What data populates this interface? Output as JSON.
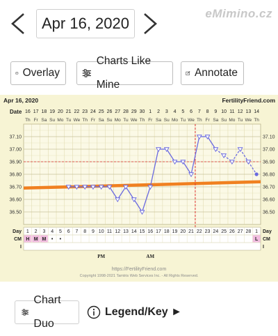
{
  "nav": {
    "date": "Apr 16, 2020",
    "brand": "eMimino.cz"
  },
  "actions": [
    {
      "id": "overlay",
      "label": "Overlay",
      "icon": "overlay-icon"
    },
    {
      "id": "charts_like_mine",
      "label": "Charts Like Mine",
      "icon": "sliders-icon"
    },
    {
      "id": "annotate",
      "label": "Annotate",
      "icon": "edit-icon"
    }
  ],
  "chart": {
    "header_date": "Apr 16, 2020",
    "site": "FertilityFriend.com",
    "date_label": "Date",
    "dates": [
      "16",
      "17",
      "18",
      "19",
      "20",
      "21",
      "22",
      "23",
      "24",
      "25",
      "26",
      "27",
      "28",
      "29",
      "30",
      "1",
      "2",
      "3",
      "4",
      "5",
      "6",
      "7",
      "8",
      "9",
      "10",
      "11",
      "12",
      "13",
      "14"
    ],
    "weekdays": [
      "Th",
      "Fr",
      "Sa",
      "Su",
      "Mo",
      "Tu",
      "We",
      "Th",
      "Fr",
      "Sa",
      "Su",
      "Mo",
      "Tu",
      "We",
      "Th",
      "Fr",
      "Sa",
      "Su",
      "Mo",
      "Tu",
      "We",
      "Th",
      "Fr",
      "Sa",
      "Su",
      "Mo",
      "Tu",
      "We",
      "Th"
    ],
    "day_label": "Day",
    "days": [
      "1",
      "2",
      "3",
      "4",
      "5",
      "6",
      "7",
      "8",
      "9",
      "10",
      "11",
      "12",
      "13",
      "14",
      "15",
      "16",
      "17",
      "18",
      "19",
      "20",
      "21",
      "22",
      "23",
      "24",
      "25",
      "26",
      "27",
      "28",
      "1"
    ],
    "cm_label": "CM",
    "cm": [
      "H",
      "M",
      "M",
      "•",
      "•",
      "",
      "",
      "",
      "",
      "",
      "",
      "",
      "",
      "",
      "",
      "",
      "",
      "",
      "",
      "",
      "",
      "",
      "",
      "",
      "",
      "",
      "",
      "",
      "L"
    ],
    "i_label": "I",
    "notes": {
      "pm": "PM",
      "am": "AM"
    },
    "y_ticks": [
      "37.10",
      "37.00",
      "36.90",
      "36.80",
      "36.70",
      "36.60",
      "36.50"
    ],
    "footer_url": "https://FertilityFriend.com",
    "footer_copy": "Copyright 1998-2021 Tamtris Web Services Inc. - All Rights Reserved.",
    "colors": {
      "bg": "#f7f4d4",
      "line": "#6a6ae0",
      "coverline": "#f08020",
      "ovulation": "#e03030",
      "cm_fertile": "#f2bde0"
    }
  },
  "chart_data": {
    "type": "line",
    "x": [
      1,
      2,
      3,
      4,
      5,
      6,
      7,
      8,
      9,
      10,
      11,
      12,
      13,
      14,
      15,
      16,
      17,
      18,
      19,
      20,
      21,
      22,
      23,
      24,
      25,
      26,
      27,
      28,
      29
    ],
    "series": [
      {
        "values": [
          null,
          null,
          null,
          null,
          null,
          36.7,
          36.7,
          36.7,
          36.7,
          36.7,
          36.7,
          36.6,
          36.7,
          36.6,
          36.5,
          36.7,
          37.0,
          37.0,
          36.9,
          36.9,
          36.8,
          37.1,
          37.1,
          37.0,
          36.95,
          36.9,
          37.0,
          36.9,
          36.8
        ]
      }
    ],
    "coverline": [
      36.69,
      36.74
    ],
    "ovulation_day": 21,
    "ylim": [
      36.4,
      37.2
    ]
  },
  "bottom": {
    "chart_duo": "Chart Duo",
    "legend": "Legend/Key ►"
  }
}
